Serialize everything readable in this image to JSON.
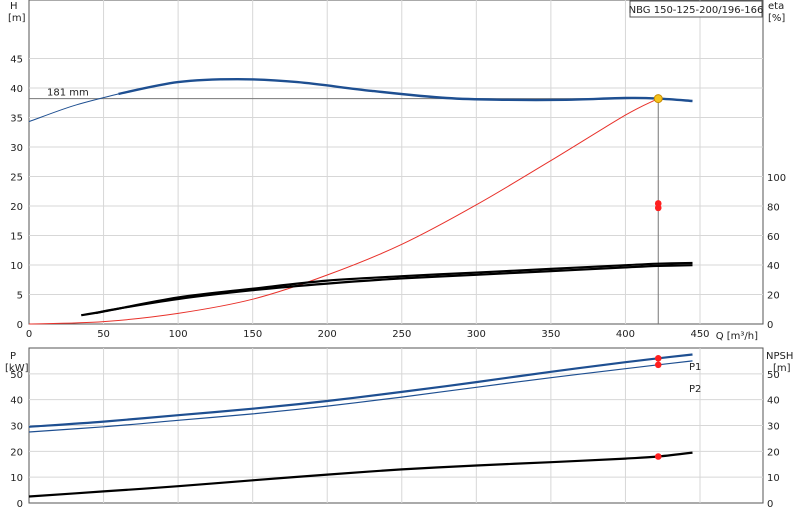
{
  "chart_data": [
    {
      "type": "line",
      "panel": "head-efficiency",
      "title": "NBG 150-125-200/196-166",
      "xlabel": "Q [m³/h]",
      "xlim": [
        0,
        450
      ],
      "xticks": [
        0,
        50,
        100,
        150,
        200,
        250,
        300,
        350,
        400,
        450
      ],
      "ylabel_left": [
        "H",
        "[m]"
      ],
      "ylim_left": [
        0,
        50
      ],
      "yticks_left": [
        0,
        5,
        10,
        15,
        20,
        25,
        30,
        35,
        40,
        45
      ],
      "ylabel_right": [
        "eta",
        "[%]"
      ],
      "ylim_right": [
        0,
        100
      ],
      "yticks_right": [
        0,
        20,
        40,
        60,
        80,
        100
      ],
      "annotation": "181 mm",
      "grid": true,
      "operating_point": {
        "q": 422,
        "h": 38.2,
        "eta_upper": 82,
        "eta_lower": 79
      },
      "series": [
        {
          "key": "h_curve",
          "axis": "left",
          "color": "#1e4f91",
          "x": [
            0,
            30,
            60,
            100,
            140,
            180,
            230,
            280,
            320,
            360,
            400,
            422,
            445
          ],
          "y": [
            34.3,
            37.0,
            39.0,
            41.0,
            41.5,
            41.0,
            39.5,
            38.3,
            38.0,
            38.0,
            38.3,
            38.2,
            37.8
          ]
        },
        {
          "key": "system_curve",
          "axis": "left",
          "color": "#e8312a",
          "x": [
            0,
            50,
            100,
            150,
            200,
            250,
            300,
            350,
            400,
            422
          ],
          "y": [
            0,
            0.4,
            1.8,
            4.2,
            8.3,
            13.5,
            20.2,
            27.7,
            35.4,
            38.2
          ]
        },
        {
          "key": "eta_upper",
          "axis": "right",
          "color": "#000000",
          "x": [
            35,
            50,
            100,
            150,
            200,
            250,
            300,
            350,
            400,
            422,
            445
          ],
          "y": [
            6,
            8.5,
            18,
            24,
            29.5,
            32.5,
            35,
            37.5,
            40,
            41,
            41.5
          ]
        },
        {
          "key": "eta_lower",
          "axis": "right",
          "color": "#000000",
          "x": [
            45,
            60,
            100,
            150,
            200,
            250,
            300,
            350,
            400,
            422,
            445
          ],
          "y": [
            7.5,
            10.5,
            17,
            23,
            27.5,
            31,
            33.5,
            36,
            38.5,
            39.5,
            40
          ]
        }
      ]
    },
    {
      "type": "line",
      "panel": "power-npsh",
      "ylabel_left": [
        "P",
        "[kW]"
      ],
      "ylim_left": [
        0,
        60
      ],
      "yticks_left": [
        0,
        10,
        20,
        30,
        40,
        50
      ],
      "ylabel_right": [
        "NPSH",
        "[m]"
      ],
      "ylim_right": [
        0,
        60
      ],
      "yticks_right": [
        0,
        10,
        20,
        30,
        40,
        50
      ],
      "xlim": [
        0,
        450
      ],
      "grid": true,
      "operating_point": {
        "q": 422,
        "p1": 56,
        "p2": 53.5,
        "npsh": 18
      },
      "series": [
        {
          "name": "P1",
          "key": "p1",
          "axis": "left",
          "color": "#1e4f91",
          "x": [
            0,
            50,
            100,
            150,
            200,
            250,
            300,
            350,
            400,
            422,
            445
          ],
          "y": [
            29.5,
            31.5,
            34,
            36.5,
            39.5,
            43,
            46.8,
            50.8,
            54.5,
            56,
            57.5
          ]
        },
        {
          "name": "P2",
          "key": "p2",
          "axis": "left",
          "color": "#1e4f91",
          "x": [
            0,
            50,
            100,
            150,
            200,
            250,
            300,
            350,
            400,
            422,
            445
          ],
          "y": [
            27.5,
            29.5,
            32,
            34.5,
            37.5,
            41,
            44.8,
            48.5,
            52,
            53.5,
            55
          ]
        },
        {
          "key": "npsh",
          "axis": "right",
          "color": "#000000",
          "x": [
            0,
            50,
            100,
            150,
            200,
            250,
            300,
            350,
            400,
            422,
            445
          ],
          "y": [
            2.5,
            4.5,
            6.5,
            8.8,
            11,
            13,
            14.5,
            15.8,
            17.2,
            18,
            19.5
          ]
        }
      ]
    }
  ]
}
